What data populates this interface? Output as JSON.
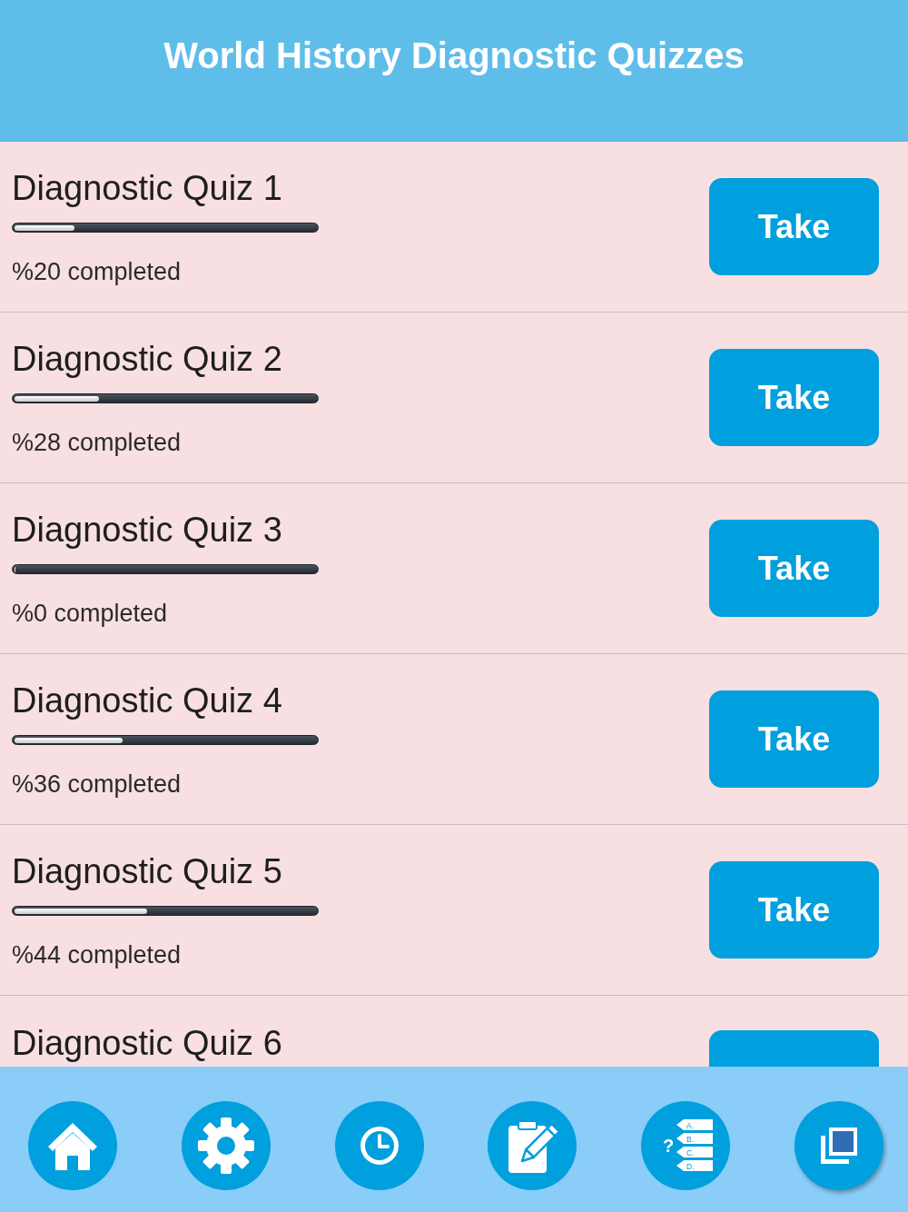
{
  "header": {
    "title": "World History Diagnostic Quizzes"
  },
  "quizzes": [
    {
      "kind": "full",
      "title": "Diagnostic Quiz 1",
      "level": 0.2,
      "reading": "%20 completed",
      "button": "Take"
    },
    {
      "kind": "full",
      "title": "Diagnostic Quiz 2",
      "level": 0.28,
      "reading": "%28 completed",
      "button": "Take"
    },
    {
      "kind": "full",
      "title": "Diagnostic Quiz 3",
      "level": 0,
      "reading": "%0 completed",
      "button": "Take"
    },
    {
      "kind": "full",
      "title": "Diagnostic Quiz 4",
      "level": 0.36,
      "reading": "%36 completed",
      "button": "Take"
    },
    {
      "kind": "full",
      "title": "Diagnostic Quiz 5",
      "level": 0.44,
      "reading": "%44 completed",
      "button": "Take"
    },
    {
      "kind": "clipped",
      "title": "Diagnostic Quiz 6"
    }
  ],
  "tab_bar": {
    "buttons": [
      {
        "kind": "home"
      },
      {
        "kind": "settings"
      },
      {
        "kind": "history"
      },
      {
        "kind": "notes"
      },
      {
        "kind": "quiz",
        "mark": "?",
        "labels": [
          "A.",
          "B.",
          "C.",
          "D."
        ]
      },
      {
        "kind": "copy"
      }
    ]
  }
}
